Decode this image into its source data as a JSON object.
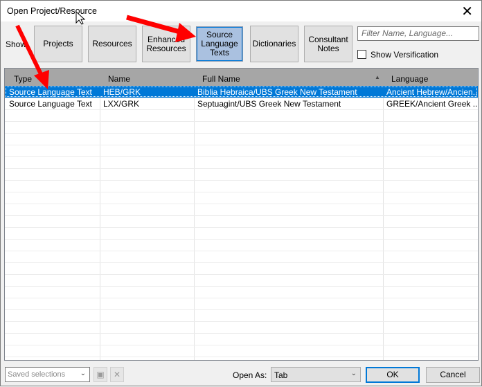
{
  "window": {
    "title": "Open Project/Resource",
    "close_icon": "close-icon"
  },
  "toolbar": {
    "show_label": "Show:",
    "buttons": [
      {
        "label": "Projects",
        "active": false
      },
      {
        "label": "Resources",
        "active": false
      },
      {
        "label": "Enhanced Resources",
        "active": false
      },
      {
        "label": "Source Language Texts",
        "active": true
      },
      {
        "label": "Dictionaries",
        "active": false
      },
      {
        "label": "Consultant Notes",
        "active": false
      }
    ],
    "filter_placeholder": "Filter Name, Language...",
    "show_versification": {
      "label": "Show Versification",
      "checked": false
    }
  },
  "table": {
    "columns": [
      "Type",
      "Name",
      "Full Name",
      "Language"
    ],
    "sorted_column": "Full Name",
    "sort_direction": "ascending",
    "rows": [
      {
        "type": "Source Language Text",
        "name": "HEB/GRK",
        "full_name": "Biblia Hebraica/UBS Greek New Testament",
        "language": "Ancient Hebrew/Ancien...",
        "selected": true
      },
      {
        "type": "Source Language Text",
        "name": "LXX/GRK",
        "full_name": "Septuagint/UBS Greek New Testament",
        "language": "GREEK/Ancient Greek ...",
        "selected": false
      }
    ]
  },
  "footer": {
    "saved_selections_placeholder": "Saved selections",
    "open_as_label": "Open As:",
    "open_as_value": "Tab",
    "ok_label": "OK",
    "cancel_label": "Cancel"
  },
  "colors": {
    "selection": "#0078d7",
    "active_button": "#aac1e0",
    "annotation_arrow": "#ff0000"
  }
}
